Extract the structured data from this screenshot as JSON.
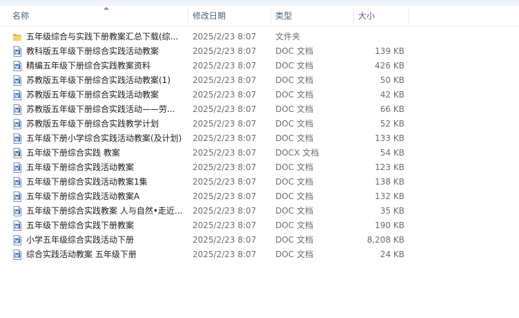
{
  "columns": {
    "name": "名称",
    "date": "修改日期",
    "type": "类型",
    "size": "大小"
  },
  "files": [
    {
      "name": "五年级综合与实践下册教案汇总下载(综...",
      "date": "2025/2/23 8:07",
      "type": "文件夹",
      "size": "",
      "icon": "folder-icon"
    },
    {
      "name": "教科版五年级下册综合实践活动教案",
      "date": "2025/2/23 8:07",
      "type": "DOC 文档",
      "size": "139 KB",
      "icon": "word-doc-icon"
    },
    {
      "name": "精编五年级下册综合实践教案资料",
      "date": "2025/2/23 8:07",
      "type": "DOC 文档",
      "size": "426 KB",
      "icon": "word-doc-icon"
    },
    {
      "name": "苏教版五年级下册综合实践活动教案(1)",
      "date": "2025/2/23 8:07",
      "type": "DOC 文档",
      "size": "50 KB",
      "icon": "word-doc-icon"
    },
    {
      "name": "苏教版五年级下册综合实践活动教案",
      "date": "2025/2/23 8:07",
      "type": "DOC 文档",
      "size": "42 KB",
      "icon": "word-doc-icon"
    },
    {
      "name": "苏教版五年级下册综合实践活动——劳...",
      "date": "2025/2/23 8:07",
      "type": "DOC 文档",
      "size": "66 KB",
      "icon": "word-doc-icon"
    },
    {
      "name": "苏教版五年级下册综合实践教学计划",
      "date": "2025/2/23 8:07",
      "type": "DOC 文档",
      "size": "52 KB",
      "icon": "word-doc-icon"
    },
    {
      "name": "五年级下册小学综合实践活动教案(及计划)",
      "date": "2025/2/23 8:07",
      "type": "DOC 文档",
      "size": "133 KB",
      "icon": "word-doc-icon"
    },
    {
      "name": "五年级下册综合实践 教案",
      "date": "2025/2/23 8:07",
      "type": "DOCX 文档",
      "size": "54 KB",
      "icon": "word-docx-icon"
    },
    {
      "name": "五年级下册综合实践活动教案",
      "date": "2025/2/23 8:07",
      "type": "DOC 文档",
      "size": "123 KB",
      "icon": "word-doc-icon"
    },
    {
      "name": "五年级下册综合实践活动教案1集",
      "date": "2025/2/23 8:07",
      "type": "DOC 文档",
      "size": "138 KB",
      "icon": "word-doc-icon"
    },
    {
      "name": "五年级下册综合实践活动教案A",
      "date": "2025/2/23 8:07",
      "type": "DOC 文档",
      "size": "132 KB",
      "icon": "word-doc-icon"
    },
    {
      "name": "五年级下册综合实践教案 人与自然•走近...",
      "date": "2025/2/23 8:07",
      "type": "DOC 文档",
      "size": "35 KB",
      "icon": "word-doc-icon"
    },
    {
      "name": "五年级下册综合实践下册教案",
      "date": "2025/2/23 8:07",
      "type": "DOC 文档",
      "size": "190 KB",
      "icon": "word-doc-icon"
    },
    {
      "name": "小学五年级综合实践活动下册",
      "date": "2025/2/23 8:07",
      "type": "DOC 文档",
      "size": "8,208 KB",
      "icon": "word-doc-icon"
    },
    {
      "name": "综合实践活动教案 五年级下册",
      "date": "2025/2/23 8:07",
      "type": "DOC 文档",
      "size": "24 KB",
      "icon": "word-doc-icon"
    }
  ]
}
